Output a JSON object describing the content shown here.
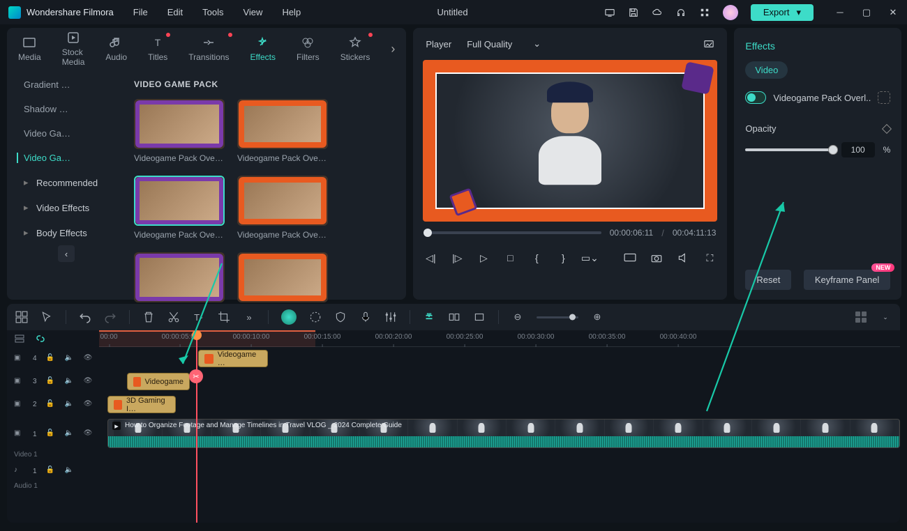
{
  "app": {
    "name": "Wondershare Filmora",
    "title": "Untitled"
  },
  "menus": [
    "File",
    "Edit",
    "Tools",
    "View",
    "Help"
  ],
  "export": "Export",
  "mediaTabs": [
    {
      "label": "Media",
      "icon": "media"
    },
    {
      "label": "Stock Media",
      "icon": "stock"
    },
    {
      "label": "Audio",
      "icon": "audio"
    },
    {
      "label": "Titles",
      "icon": "titles",
      "dot": true
    },
    {
      "label": "Transitions",
      "icon": "transitions",
      "dot": true
    },
    {
      "label": "Effects",
      "icon": "effects",
      "active": true
    },
    {
      "label": "Filters",
      "icon": "filters"
    },
    {
      "label": "Stickers",
      "icon": "stickers",
      "dot": true
    }
  ],
  "sidebar": {
    "items": [
      {
        "label": "Gradient …"
      },
      {
        "label": "Shadow …"
      },
      {
        "label": "Video Ga…"
      },
      {
        "label": "Video Ga…",
        "active": true
      }
    ],
    "groups": [
      {
        "label": "Recommended"
      },
      {
        "label": "Video Effects"
      },
      {
        "label": "Body Effects"
      }
    ]
  },
  "panelTitle": "VIDEO GAME PACK",
  "cards": [
    {
      "label": "Videogame Pack Overl…",
      "frame": "purple"
    },
    {
      "label": "Videogame Pack Overl…",
      "frame": "orange"
    },
    {
      "label": "Videogame Pack Overl…",
      "frame": "purple",
      "sel": true
    },
    {
      "label": "Videogame Pack Overl…",
      "frame": "orange"
    },
    {
      "label": "",
      "frame": "purple"
    },
    {
      "label": "",
      "frame": "orange"
    }
  ],
  "preview": {
    "player": "Player",
    "quality": "Full Quality",
    "timeCurrent": "00:00:06:11",
    "timeTotal": "00:04:11:13"
  },
  "rightPanel": {
    "tab": "Effects",
    "subTab": "Video",
    "effectName": "Videogame Pack Overl..",
    "opacityLabel": "Opacity",
    "opacityValue": "100",
    "pct": "%",
    "reset": "Reset",
    "keyframe": "Keyframe Panel",
    "badge": "NEW"
  },
  "timeline": {
    "ticks": [
      "00:00",
      "00:00:05:00",
      "00:00:10:00",
      "00:00:15:00",
      "00:00:20:00",
      "00:00:25:00",
      "00:00:30:00",
      "00:00:35:00",
      "00:00:40:00"
    ],
    "tracks": {
      "fx4": "4",
      "fx3": "3",
      "fx2": "2",
      "vid1": "1",
      "videoLabel": "Video 1",
      "audioLabel": "Audio 1",
      "aud1": "1"
    },
    "clips": {
      "fx4": "Videogame …",
      "fx3": "Videogame",
      "fx2": "3D Gaming I…",
      "video": "How to Organize Footage and Manage Timelines in Travel VLOG _ 2024 Complete Guide"
    }
  }
}
